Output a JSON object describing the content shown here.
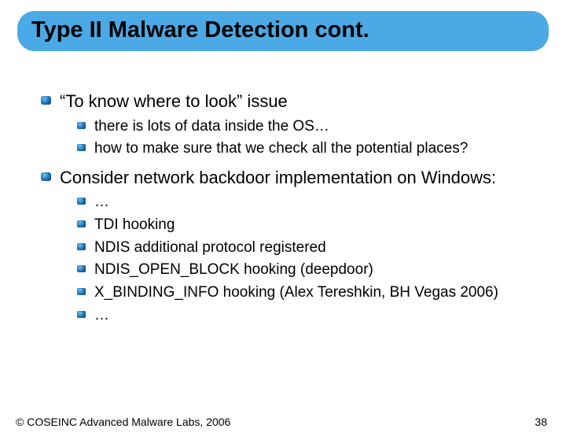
{
  "slide": {
    "title": "Type II Malware Detection cont.",
    "bullets": [
      {
        "text": "“To know where to look” issue",
        "children": [
          "there is lots of data inside the OS…",
          "how to make sure that we check all the potential places?"
        ]
      },
      {
        "text": "Consider network backdoor implementation on Windows:",
        "children": [
          "…",
          "TDI hooking",
          "NDIS additional protocol registered",
          "NDIS_OPEN_BLOCK hooking (deepdoor)",
          "X_BINDING_INFO hooking (Alex Tereshkin, BH Vegas 2006)",
          "…"
        ]
      }
    ],
    "footer_left": "© COSEINC Advanced Malware Labs, 2006",
    "page_number": "38"
  }
}
